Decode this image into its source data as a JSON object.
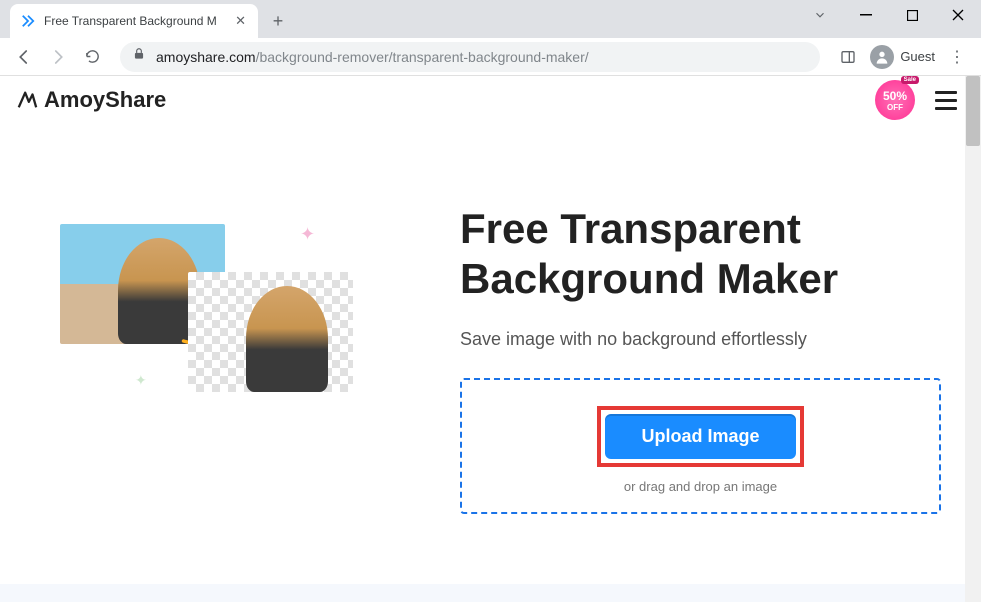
{
  "browser": {
    "tab_title": "Free Transparent Background M",
    "url_domain": "amoyshare.com",
    "url_path": "/background-remover/transparent-background-maker/",
    "guest_label": "Guest"
  },
  "header": {
    "brand_name": "AmoyShare",
    "sale_ribbon": "Sale",
    "sale_percent": "50%",
    "sale_off": "OFF"
  },
  "hero": {
    "title_line1": "Free Transparent",
    "title_line2": "Background Maker",
    "subtitle": "Save image with no background effortlessly",
    "upload_button_label": "Upload Image",
    "dnd_text": "or drag and drop an image"
  },
  "colors": {
    "accent": "#1a8cff",
    "highlight_box": "#e53935",
    "dashed_border": "#1a73e8"
  }
}
